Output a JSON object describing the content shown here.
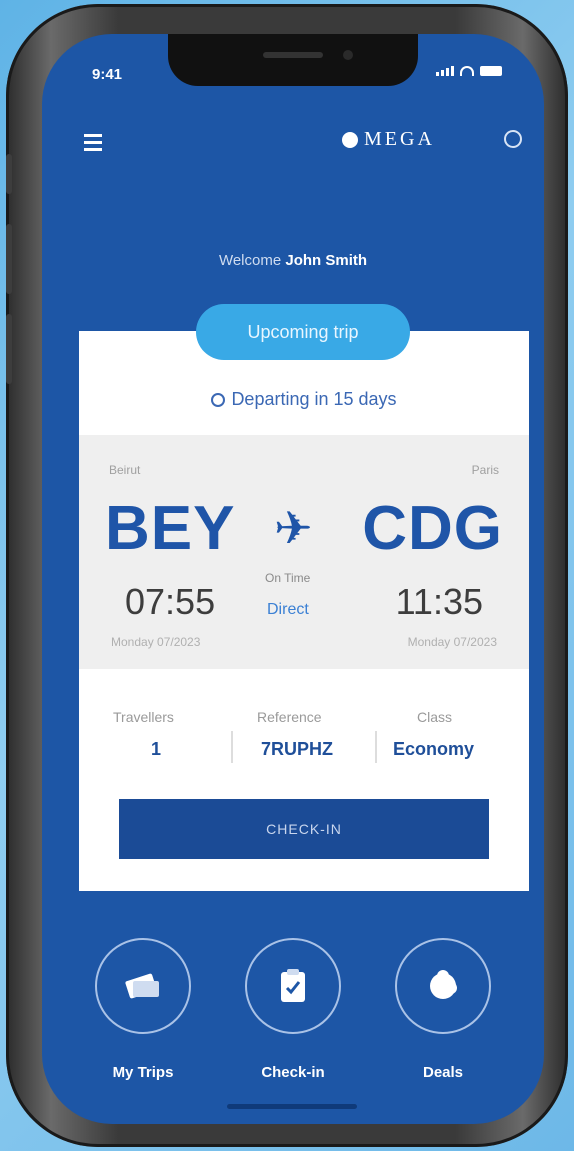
{
  "status_bar": {
    "time": "9:41"
  },
  "header": {
    "brand": "MEGA"
  },
  "welcome": {
    "prefix": "Welcome",
    "name": "John Smith"
  },
  "trip_card": {
    "badge": "Upcoming trip",
    "departing_text": "Departing in 15 days",
    "origin": {
      "label": "Beirut",
      "code": "BEY",
      "time": "07:55",
      "date": "Monday 07/2023"
    },
    "destination": {
      "label": "Paris",
      "code": "CDG",
      "time": "11:35",
      "date": "Monday 07/2023"
    },
    "flight_status": {
      "label": "On Time",
      "value": "Direct"
    },
    "travellers": {
      "label": "Travellers",
      "value": "1"
    },
    "reference": {
      "label": "Reference",
      "value": "7RUPHZ"
    },
    "cabin_class": {
      "label": "Class",
      "value": "Economy"
    },
    "checkin_button": "CHECK-IN"
  },
  "bottom_nav": [
    {
      "label": "My Trips",
      "icon": "ticket-icon"
    },
    {
      "label": "Check-in",
      "icon": "clipboard-icon"
    },
    {
      "label": "Deals",
      "icon": "tag-icon"
    }
  ],
  "colors": {
    "primary": "#1d56a6",
    "accent": "#39a9e6",
    "button": "#1b4b96"
  }
}
